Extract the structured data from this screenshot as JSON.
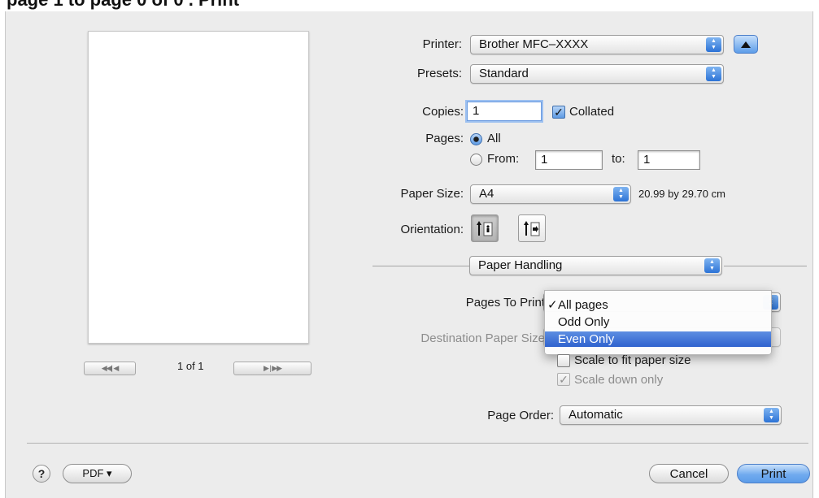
{
  "caption": "page 1 to page 0 of 0 . Print",
  "preview": {
    "page_indicator": "1 of 1",
    "prev_symbol": "◀◀| ◀",
    "next_symbol": "▶ | ▶▶"
  },
  "printer": {
    "label": "Printer:",
    "value": "Brother MFC–XXXX",
    "icon": "chevron-up-icon"
  },
  "presets": {
    "label": "Presets:",
    "value": "Standard"
  },
  "copies": {
    "label": "Copies:",
    "value": "1",
    "collated_label": "Collated",
    "collated": true
  },
  "pages": {
    "label": "Pages:",
    "all_label": "All",
    "from_label": "From:",
    "from_value": "1",
    "to_label": "to:",
    "to_value": "1",
    "selected": "All"
  },
  "paper_size": {
    "label": "Paper Size:",
    "value": "A4",
    "dimensions": "20.99 by 29.70 cm"
  },
  "orientation": {
    "label": "Orientation:",
    "selected": "portrait",
    "icons": [
      "portrait-orientation-icon",
      "landscape-orientation-icon"
    ]
  },
  "section": {
    "value": "Paper Handling"
  },
  "pages_to_print": {
    "label": "Pages To Print",
    "options": [
      "All pages",
      "Odd Only",
      "Even Only"
    ],
    "checked": "All pages",
    "highlighted": "Even Only"
  },
  "destination": {
    "label": "Destination Paper Size"
  },
  "scale_to_fit": {
    "label": "Scale to fit paper size",
    "checked": false
  },
  "scale_down": {
    "label": "Scale down only",
    "checked": true,
    "disabled": true
  },
  "page_order": {
    "label": "Page Order:",
    "value": "Automatic"
  },
  "footer": {
    "help": "?",
    "pdf_label": "PDF ▾",
    "cancel_label": "Cancel",
    "print_label": "Print"
  },
  "colors": {
    "accent": "#3a77d9",
    "highlight": "#3a6fd6"
  }
}
